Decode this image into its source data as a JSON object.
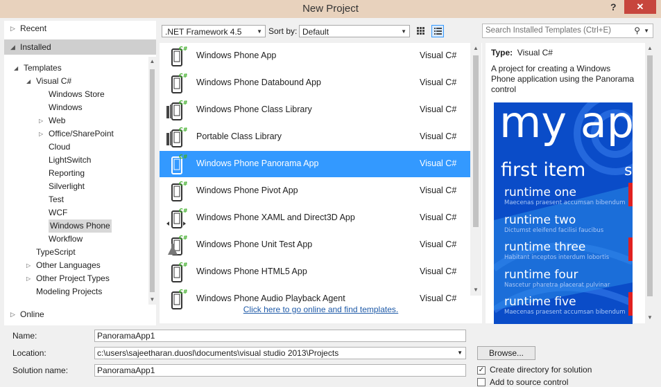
{
  "window": {
    "title": "New Project",
    "help_label": "?",
    "close_label": "✕"
  },
  "left_panel": {
    "recent": "Recent",
    "installed": "Installed",
    "online": "Online",
    "tree": [
      {
        "label": "Templates",
        "indent": 0,
        "arrow": "◢",
        "selected": false
      },
      {
        "label": "Visual C#",
        "indent": 1,
        "arrow": "◢",
        "selected": false
      },
      {
        "label": "Windows Store",
        "indent": 2,
        "arrow": "",
        "selected": false
      },
      {
        "label": "Windows",
        "indent": 2,
        "arrow": "",
        "selected": false
      },
      {
        "label": "Web",
        "indent": 2,
        "arrow": "▷",
        "selected": false
      },
      {
        "label": "Office/SharePoint",
        "indent": 2,
        "arrow": "▷",
        "selected": false
      },
      {
        "label": "Cloud",
        "indent": 2,
        "arrow": "",
        "selected": false
      },
      {
        "label": "LightSwitch",
        "indent": 2,
        "arrow": "",
        "selected": false
      },
      {
        "label": "Reporting",
        "indent": 2,
        "arrow": "",
        "selected": false
      },
      {
        "label": "Silverlight",
        "indent": 2,
        "arrow": "",
        "selected": false
      },
      {
        "label": "Test",
        "indent": 2,
        "arrow": "",
        "selected": false
      },
      {
        "label": "WCF",
        "indent": 2,
        "arrow": "",
        "selected": false
      },
      {
        "label": "Windows Phone",
        "indent": 2,
        "arrow": "",
        "selected": true
      },
      {
        "label": "Workflow",
        "indent": 2,
        "arrow": "",
        "selected": false
      },
      {
        "label": "TypeScript",
        "indent": 1,
        "arrow": "",
        "selected": false
      },
      {
        "label": "Other Languages",
        "indent": 1,
        "arrow": "▷",
        "selected": false
      },
      {
        "label": "Other Project Types",
        "indent": 1,
        "arrow": "▷",
        "selected": false
      },
      {
        "label": "Modeling Projects",
        "indent": 1,
        "arrow": "",
        "selected": false
      }
    ]
  },
  "toolbar": {
    "framework": ".NET Framework 4.5",
    "sort_label": "Sort by:",
    "sort_value": "Default",
    "search_placeholder": "Search Installed Templates (Ctrl+E)"
  },
  "templates": [
    {
      "name": "Windows Phone App",
      "lang": "Visual C#",
      "icon": "phone-app-icon",
      "selected": false
    },
    {
      "name": "Windows Phone Databound App",
      "lang": "Visual C#",
      "icon": "phone-databound-icon",
      "selected": false
    },
    {
      "name": "Windows Phone Class Library",
      "lang": "Visual C#",
      "icon": "class-library-icon",
      "selected": false
    },
    {
      "name": "Portable Class Library",
      "lang": "Visual C#",
      "icon": "portable-library-icon",
      "selected": false
    },
    {
      "name": "Windows Phone Panorama App",
      "lang": "Visual C#",
      "icon": "phone-panorama-icon",
      "selected": true
    },
    {
      "name": "Windows Phone Pivot App",
      "lang": "Visual C#",
      "icon": "phone-pivot-icon",
      "selected": false
    },
    {
      "name": "Windows Phone XAML and Direct3D App",
      "lang": "Visual C#",
      "icon": "phone-xaml-d3d-icon",
      "selected": false
    },
    {
      "name": "Windows Phone Unit Test App",
      "lang": "Visual C#",
      "icon": "phone-unit-test-icon",
      "selected": false
    },
    {
      "name": "Windows Phone HTML5 App",
      "lang": "Visual C#",
      "icon": "phone-html5-icon",
      "selected": false
    },
    {
      "name": "Windows Phone Audio Playback Agent",
      "lang": "Visual C#",
      "icon": "phone-audio-icon",
      "selected": false
    }
  ],
  "online_link": "Click here to go online and find templates.",
  "details": {
    "type_label": "Type:",
    "type_value": "Visual C#",
    "description": "A project for creating a Windows Phone application using the Panorama control",
    "preview": {
      "big": "my ap",
      "first": "first item",
      "second_initial": "s",
      "items": [
        {
          "title": "runtime one",
          "sub": "Maecenas praesent accumsan bibendum"
        },
        {
          "title": "runtime two",
          "sub": "Dictumst eleifend facilisi faucibus"
        },
        {
          "title": "runtime three",
          "sub": "Habitant inceptos interdum lobortis"
        },
        {
          "title": "runtime four",
          "sub": "Nascetur pharetra placerat pulvinar"
        },
        {
          "title": "runtime five",
          "sub": "Maecenas praesent accumsan bibendum"
        }
      ]
    }
  },
  "form": {
    "name_label": "Name:",
    "name_value": "PanoramaApp1",
    "location_label": "Location:",
    "location_value": "c:\\users\\sajeetharan.duosl\\documents\\visual studio 2013\\Projects",
    "solution_label": "Solution name:",
    "solution_value": "PanoramaApp1",
    "browse_label": "Browse...",
    "create_dir_label": "Create directory for solution",
    "add_source_label": "Add to source control"
  },
  "colors": {
    "selection": "#3399ff",
    "close": "#c7463d",
    "title_bar": "#e8d2bd",
    "preview_bg": "#0a4cc8",
    "link": "#1e5aa8"
  }
}
